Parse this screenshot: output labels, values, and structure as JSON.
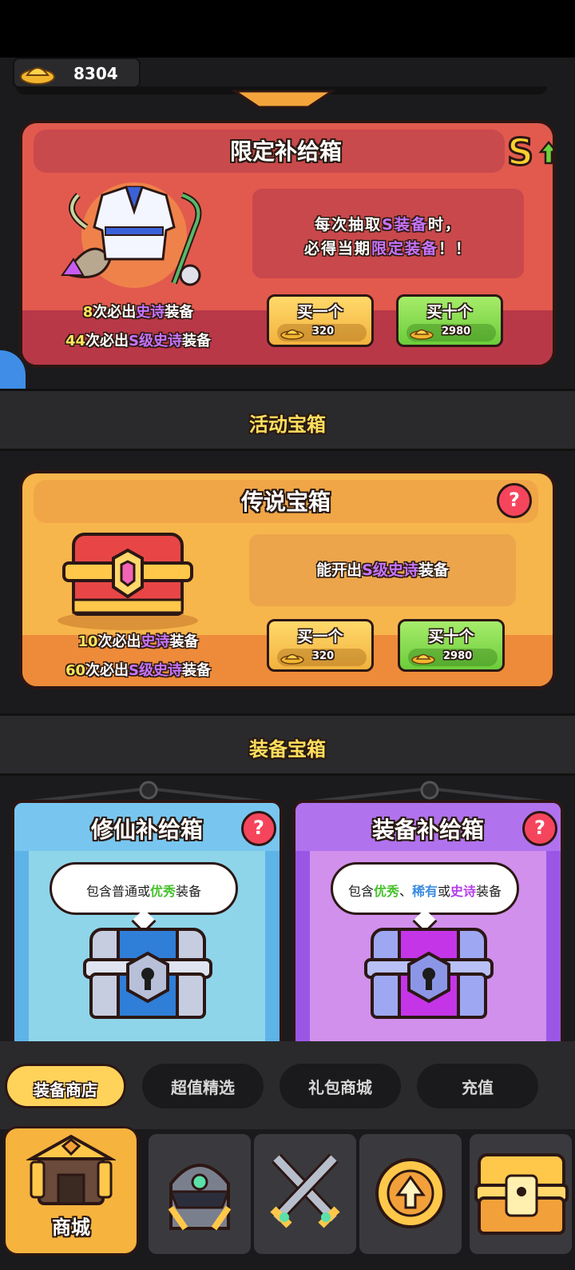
{
  "currency": {
    "gold": "8304"
  },
  "limited_box": {
    "title": "限定补给箱",
    "desc_line1_pre": "每次抽取",
    "desc_line1_hl": "S装备",
    "desc_line1_post": "时，",
    "desc_line2_pre": "必得当期",
    "desc_line2_hl": "限定装备",
    "desc_line2_post": "！！",
    "guarantee1_num": "8",
    "guarantee1_mid": "次必出",
    "guarantee1_hl": "史诗",
    "guarantee1_post": "装备",
    "guarantee2_num": "44",
    "guarantee2_mid": "次必出",
    "guarantee2_hl": "S级史诗",
    "guarantee2_post": "装备",
    "buy_one_label": "买一个",
    "buy_one_price": "320",
    "buy_ten_label": "买十个",
    "buy_ten_price": "2980"
  },
  "section_event": "活动宝箱",
  "legend_box": {
    "title": "传说宝箱",
    "help": "?",
    "desc_pre": "能开出",
    "desc_hl": "S级史诗",
    "desc_post": "装备",
    "guarantee1_num": "10",
    "guarantee1_mid": "次必出",
    "guarantee1_hl": "史诗",
    "guarantee1_post": "装备",
    "guarantee2_num": "60",
    "guarantee2_mid": "次必出",
    "guarantee2_hl": "S级史诗",
    "guarantee2_post": "装备",
    "buy_one_label": "买一个",
    "buy_one_price": "320",
    "buy_ten_label": "买十个",
    "buy_ten_price": "2980"
  },
  "section_equip": "装备宝箱",
  "cultivation_box": {
    "title": "修仙补给箱",
    "help": "?",
    "desc_pre": "包含普通或",
    "desc_hl": "优秀",
    "desc_post": "装备"
  },
  "equip_box": {
    "title": "装备补给箱",
    "help": "?",
    "desc_pre": "包含",
    "desc_hl1": "优秀",
    "desc_sep": "、",
    "desc_hl2": "稀有",
    "desc_or": "或",
    "desc_hl3": "史诗",
    "desc_post": "装备"
  },
  "shop_tabs": [
    {
      "label": "装备商店",
      "active": true
    },
    {
      "label": "超值精选",
      "active": false
    },
    {
      "label": "礼包商城",
      "active": false
    },
    {
      "label": "充值",
      "active": false
    }
  ],
  "bottom_nav": [
    {
      "label": "商城",
      "icon": "shop-house-icon",
      "active": true
    },
    {
      "label": "",
      "icon": "knight-helmet-icon",
      "active": false
    },
    {
      "label": "",
      "icon": "crossed-swords-icon",
      "active": false
    },
    {
      "label": "",
      "icon": "upgrade-arrow-icon",
      "active": false
    },
    {
      "label": "",
      "icon": "treasure-chest-icon",
      "active": false
    }
  ],
  "colors": {
    "accent_yellow": "#ffdf5e",
    "epic_purple": "#c873ff",
    "red_card": "#e25a4e",
    "orange_card": "#f7b64c"
  }
}
